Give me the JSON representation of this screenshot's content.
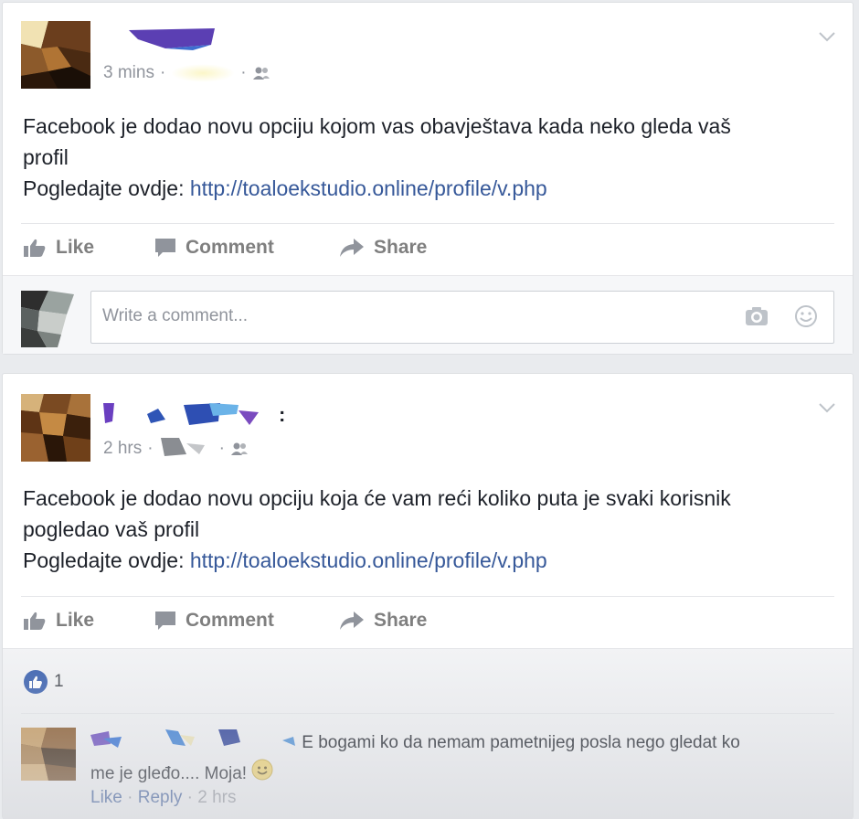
{
  "posts": [
    {
      "timestamp": "3 mins",
      "text_line1": "Facebook je dodao novu opciju kojom vas obavještava kada neko gleda vaš",
      "text_line2": "profil",
      "cta_prefix": "Pogledajte ovdje:",
      "link": "http://toaloekstudio.online/profile/v.php",
      "actions": {
        "like": "Like",
        "comment": "Comment",
        "share": "Share"
      },
      "comment_placeholder": "Write a comment..."
    },
    {
      "timestamp": "2 hrs",
      "name_suffix": ":",
      "text_line1": "Facebook je dodao novu opciju koja će vam reći koliko puta je svaki korisnik",
      "text_line2": "pogledao vaš profil",
      "cta_prefix": "Pogledajte ovdje:",
      "link": "http://toaloekstudio.online/profile/v.php",
      "actions": {
        "like": "Like",
        "comment": "Comment",
        "share": "Share"
      },
      "reaction_count": "1",
      "comment": {
        "text_line1": "E bogami ko da nemam pametnijeg posla nego gledat ko",
        "text_line2": "me je gleđo.... Moja!",
        "like": "Like",
        "reply": "Reply",
        "time": "2 hrs"
      }
    }
  ],
  "colors": {
    "link": "#365899",
    "meta": "#90949c",
    "action": "#7f7f7f",
    "like_blue": "#4267b2"
  }
}
